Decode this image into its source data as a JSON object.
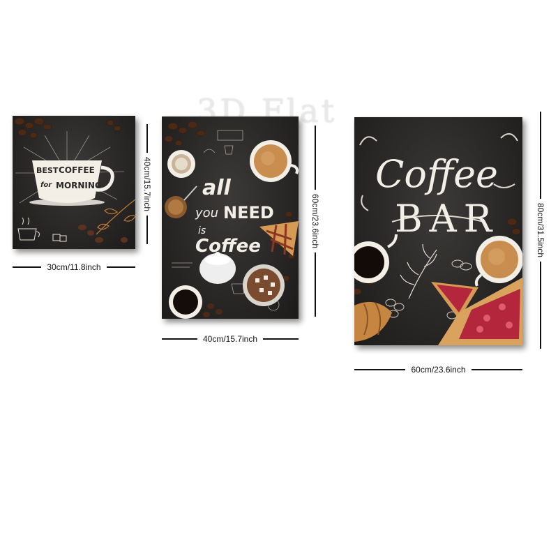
{
  "watermark": "3D Flat",
  "panels": [
    {
      "name": "best-coffee-panel",
      "width_label": "30cm/11.8inch",
      "height_label": "40cm/15.7inch",
      "art_text": [
        "BEST",
        "COFFEE",
        "for",
        "MORNING"
      ]
    },
    {
      "name": "all-you-need-panel",
      "width_label": "40cm/15.7inch",
      "height_label": "60cm/23.6inch",
      "art_text": [
        "all",
        "you",
        "NEED",
        "is",
        "Coffee"
      ]
    },
    {
      "name": "coffee-bar-panel",
      "width_label": "60cm/23.6inch",
      "height_label": "80cm/31.5inch",
      "art_text": [
        "Coffee",
        "BAR"
      ]
    }
  ],
  "colors": {
    "chalkboard": "#2a2827",
    "chalk": "#f3efe6",
    "coffee_bean": "#4a2a17",
    "crema": "#c98e4f",
    "berry": "#b3263b",
    "pastry": "#d69a55"
  }
}
